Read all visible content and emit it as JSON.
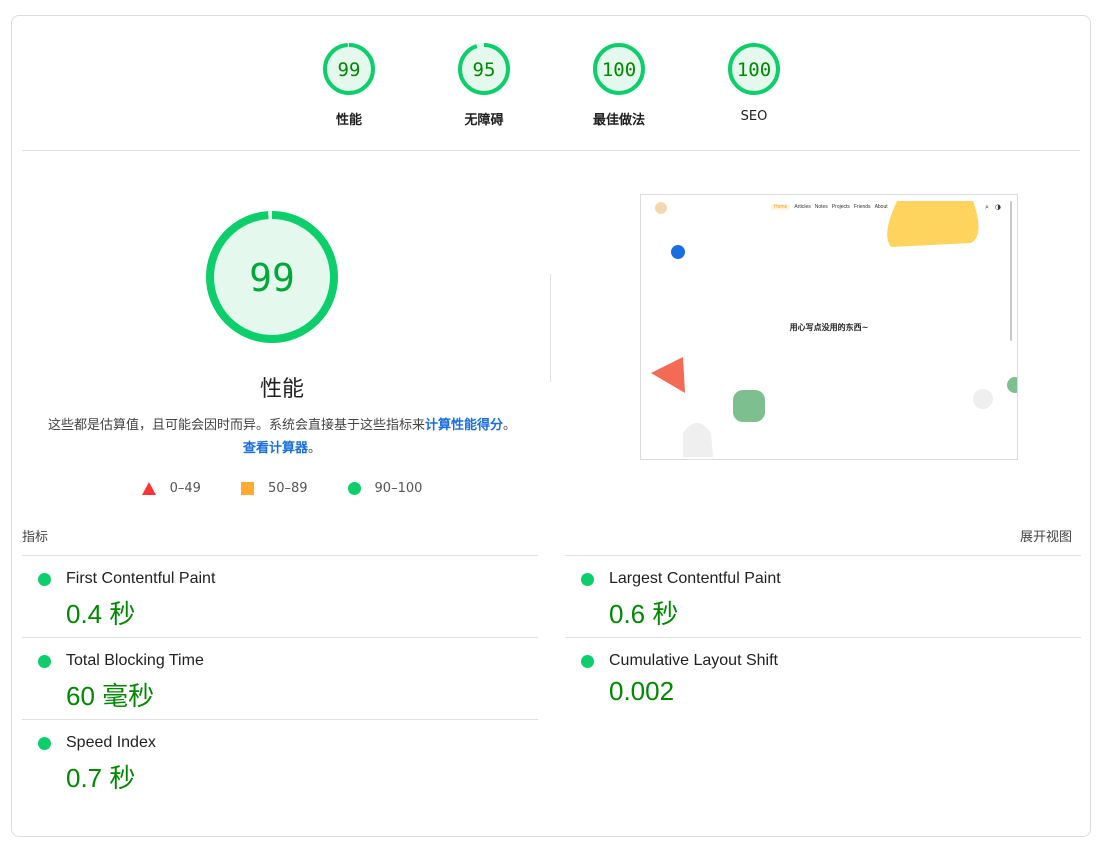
{
  "categories": [
    {
      "label": "性能",
      "score": "99",
      "value": 99
    },
    {
      "label": "无障碍",
      "score": "95",
      "value": 95
    },
    {
      "label": "最佳做法",
      "score": "100",
      "value": 100
    },
    {
      "label": "SEO",
      "score": "100",
      "value": 100
    }
  ],
  "performance": {
    "score": "99",
    "value": 99,
    "title": "性能",
    "desc_text": "这些都是估算值，且可能会因时而异。系统会直接基于这些指标来",
    "calc_link": "计算性能得分",
    "desc_mid": "。",
    "calculator_link": "查看计算器",
    "desc_end": "。"
  },
  "legend": {
    "fail": "0–49",
    "average": "50–89",
    "pass": "90–100"
  },
  "screenshot": {
    "nav": [
      "Home",
      "Articles",
      "Notes",
      "Projects",
      "Friends",
      "About"
    ],
    "hero_text": "用心写点没用的东西~"
  },
  "metrics": {
    "header": "指标",
    "expand_label": "展开视图",
    "left": [
      {
        "name": "First Contentful Paint",
        "value": "0.4 秒"
      },
      {
        "name": "Total Blocking Time",
        "value": "60 毫秒"
      },
      {
        "name": "Speed Index",
        "value": "0.7 秒"
      }
    ],
    "right": [
      {
        "name": "Largest Contentful Paint",
        "value": "0.6 秒"
      },
      {
        "name": "Cumulative Layout Shift",
        "value": "0.002"
      }
    ]
  },
  "colors": {
    "pass": "#0cce6b",
    "pass_fill": "#e5f8ed",
    "pass_text": "#008800",
    "average": "#ffaa33",
    "fail": "#ff3333",
    "link": "#1a6fe0"
  }
}
